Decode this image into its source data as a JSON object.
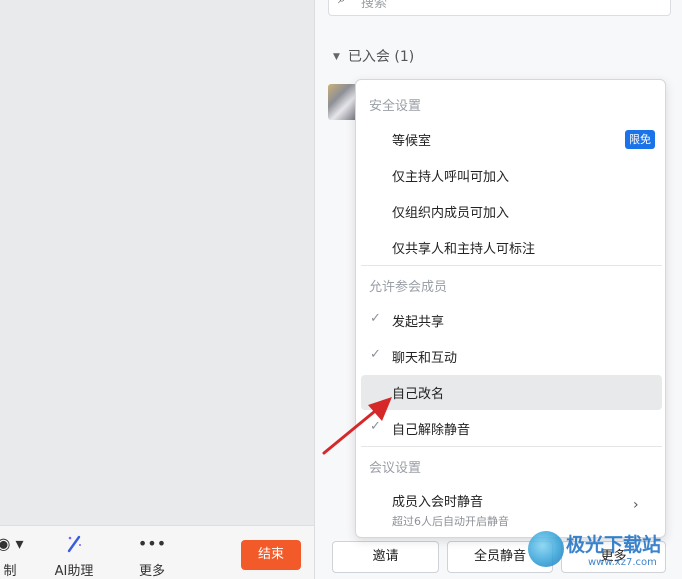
{
  "toolbar": {
    "record_label": "制",
    "ai_label": "AI助理",
    "more_label": "更多",
    "more_icon": "•••",
    "end_label": "结束"
  },
  "participants": {
    "search_placeholder": "搜索",
    "group_label": "已入会 (1)"
  },
  "menu": {
    "security_header": "安全设置",
    "security_items": [
      {
        "label": "等候室",
        "badge": "限免"
      },
      {
        "label": "仅主持人呼叫可加入"
      },
      {
        "label": "仅组织内成员可加入"
      },
      {
        "label": "仅共享人和主持人可标注"
      }
    ],
    "allow_header": "允许参会成员",
    "allow_items": [
      {
        "label": "发起共享",
        "checked": true
      },
      {
        "label": "聊天和互动",
        "checked": true
      },
      {
        "label": "自己改名",
        "checked": false
      },
      {
        "label": "自己解除静音",
        "checked": true
      }
    ],
    "meeting_header": "会议设置",
    "meeting_item": {
      "label": "成员入会时静音",
      "sub": "超过6人后自动开启静音"
    }
  },
  "footer": {
    "invite_label": "邀请",
    "mute_all_label": "全员静音",
    "more_label": "更多"
  },
  "watermark": {
    "title": "极光下载站",
    "url": "www.xz7.com"
  },
  "colors": {
    "end_button": "#f25a29",
    "badge": "#1a73e8",
    "arrow": "#d62828"
  }
}
